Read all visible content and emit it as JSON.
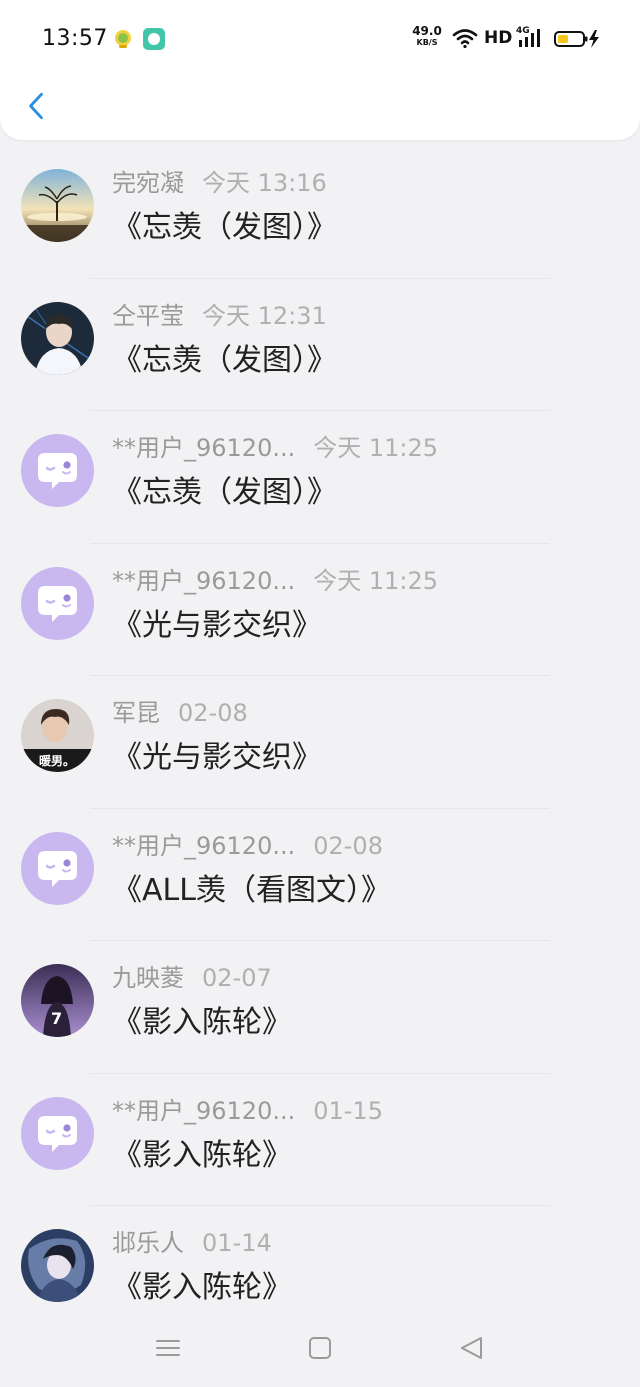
{
  "status_bar": {
    "time": "13:57",
    "net_speed_value": "49.0",
    "net_speed_unit": "KB/S",
    "hd_label": "HD",
    "network_label": "4G",
    "icons": [
      "app-notification-icon",
      "chat-notification-icon",
      "wifi-icon",
      "signal-icon",
      "battery-icon",
      "charging-icon"
    ]
  },
  "header": {
    "back_icon": "chevron-left-icon"
  },
  "colors": {
    "accent": "#2a8fe0",
    "default_avatar_bg": "#c9b8ef",
    "name_text": "#9a9a9a",
    "message_text": "#222222"
  },
  "messages": [
    {
      "name": "完宛凝",
      "time": "今天 13:16",
      "text": "《忘羡（发图）》",
      "avatar": "tree-photo-avatar"
    },
    {
      "name": "仝平莹",
      "time": "今天 12:31",
      "text": "《忘羡（发图）》",
      "avatar": "person-photo-avatar"
    },
    {
      "name": "**用户_96120...",
      "time": "今天 11:25",
      "text": "《忘羡（发图）》",
      "avatar": "default-chat-avatar"
    },
    {
      "name": "**用户_96120...",
      "time": "今天 11:25",
      "text": "《光与影交织》",
      "avatar": "default-chat-avatar"
    },
    {
      "name": "军昆",
      "time": "02-08",
      "text": "《光与影交织》",
      "avatar": "person-photo-avatar",
      "avatar_caption": "暖男。"
    },
    {
      "name": "**用户_96120...",
      "time": "02-08",
      "text": "《ALL羡（看图文）》",
      "avatar": "default-chat-avatar"
    },
    {
      "name": "九映菱",
      "time": "02-07",
      "text": "《影入陈轮》",
      "avatar": "person-photo-avatar",
      "avatar_caption": "7"
    },
    {
      "name": "**用户_96120...",
      "time": "01-15",
      "text": "《影入陈轮》",
      "avatar": "default-chat-avatar"
    },
    {
      "name": "邶乐人",
      "time": "01-14",
      "text": "《影入陈轮》",
      "avatar": "anime-photo-avatar"
    }
  ],
  "nav_bar": {
    "icons": [
      "menu-icon",
      "home-square-icon",
      "back-triangle-icon"
    ]
  }
}
